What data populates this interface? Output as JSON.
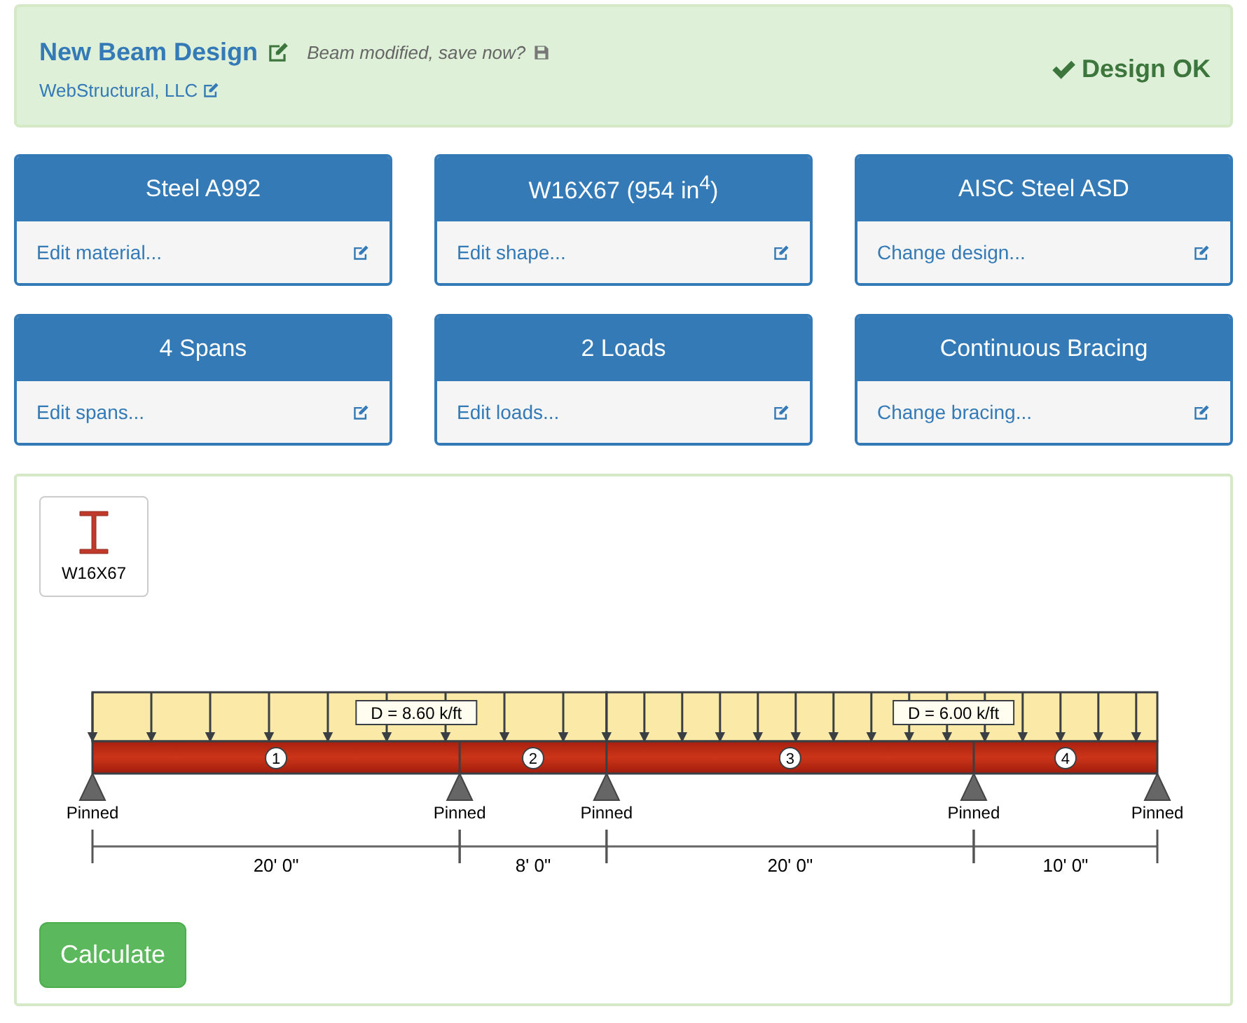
{
  "header": {
    "title": "New Beam Design",
    "status_note": "Beam modified, save now?",
    "company": "WebStructural, LLC",
    "design_status": "Design OK"
  },
  "cards": [
    {
      "title": "Steel A992",
      "link": "Edit material..."
    },
    {
      "title": "W16X67 (954 in$^{4}$)",
      "link": "Edit shape..."
    },
    {
      "title": "AISC Steel ASD",
      "link": "Change design..."
    },
    {
      "title": "4 Spans",
      "link": "Edit spans..."
    },
    {
      "title": "2 Loads",
      "link": "Edit loads..."
    },
    {
      "title": "Continuous Bracing",
      "link": "Change bracing..."
    }
  ],
  "shape_thumbnail": {
    "label": "W16X67"
  },
  "diagram": {
    "supports": [
      {
        "label": "Pinned"
      },
      {
        "label": "Pinned"
      },
      {
        "label": "Pinned"
      },
      {
        "label": "Pinned"
      },
      {
        "label": "Pinned"
      }
    ],
    "spans": [
      {
        "number": "1",
        "length": "20' 0\""
      },
      {
        "number": "2",
        "length": "8' 0\""
      },
      {
        "number": "3",
        "length": "20' 0\""
      },
      {
        "number": "4",
        "length": "10' 0\""
      }
    ],
    "loads": [
      {
        "label": "D = 8.60 k/ft"
      },
      {
        "label": "D = 6.00 k/ft"
      }
    ]
  },
  "calculate_button": "Calculate"
}
